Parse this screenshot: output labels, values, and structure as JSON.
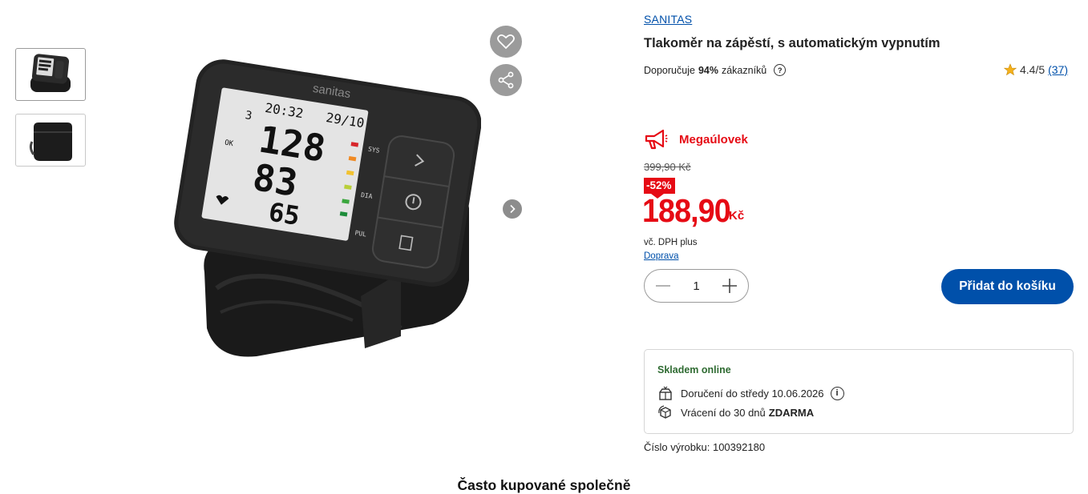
{
  "gallery": {
    "thumbnails": [
      {
        "icon": "blood-pressure-monitor-front-thumbnail"
      },
      {
        "icon": "blood-pressure-monitor-case-thumbnail"
      }
    ],
    "main_image_icon": "sanitas-wrist-blood-pressure-monitor",
    "device_screen": {
      "brand": "sanitas",
      "time": "20:32",
      "date": "29/10",
      "memory": "3",
      "systolic": "128",
      "diastolic": "83",
      "pulse": "65",
      "label_sys": "SYS",
      "label_dia": "DIA",
      "label_pul": "PUL",
      "label_ok": "OK"
    }
  },
  "product": {
    "brand": "SANITAS",
    "title": "Tlakoměr na zápěstí, s automatickým vypnutím",
    "recommend_prefix": "Doporučuje",
    "recommend_percent": "94%",
    "recommend_suffix": "zákazníků",
    "rating": "4.4/5",
    "rating_count": "(37)"
  },
  "offer": {
    "badge": "Megaúlovek",
    "old_price": "399,90 Kč",
    "discount": "-52%",
    "price": "188,90",
    "currency": "Kč",
    "vat_note": "vč. DPH plus",
    "shipping_link": "Doprava"
  },
  "cart": {
    "quantity": "1",
    "add_label": "Přidat do košíku"
  },
  "availability": {
    "title": "Skladem online",
    "delivery": "Doručení do středy 10.06.2026",
    "returns_prefix": "Vrácení do 30 dnů",
    "returns_free": "ZDARMA"
  },
  "product_number": "Číslo výrobku: 100392180",
  "section_heading": "Často kupované společně",
  "colors": {
    "accent_blue": "#0050aa",
    "sale_red": "#e60a14",
    "stock_green": "#2f6b32"
  }
}
